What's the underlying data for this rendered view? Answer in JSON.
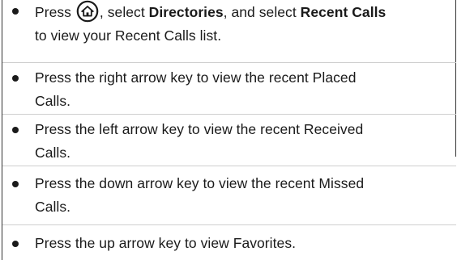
{
  "instructions": {
    "items": [
      {
        "parts": [
          {
            "t": "Press "
          },
          {
            "icon": "home-icon"
          },
          {
            "t": ", select "
          },
          {
            "b": "Directories"
          },
          {
            "t": ", and select "
          },
          {
            "b": "Recent Calls"
          },
          {
            "br": true
          },
          {
            "t": "to view your Recent Calls list."
          }
        ]
      },
      {
        "parts": [
          {
            "t": "Press the right arrow key to view the recent Placed"
          },
          {
            "br": true
          },
          {
            "t": "Calls."
          }
        ]
      },
      {
        "parts": [
          {
            "t": "Press the left arrow key to view the recent Received"
          },
          {
            "br": true
          },
          {
            "t": "Calls."
          }
        ]
      },
      {
        "parts": [
          {
            "t": "Press the down arrow key to view the recent Missed"
          },
          {
            "br": true
          },
          {
            "t": "Calls."
          }
        ]
      },
      {
        "parts": [
          {
            "t": "Press the up arrow key to view Favorites."
          }
        ]
      }
    ]
  }
}
